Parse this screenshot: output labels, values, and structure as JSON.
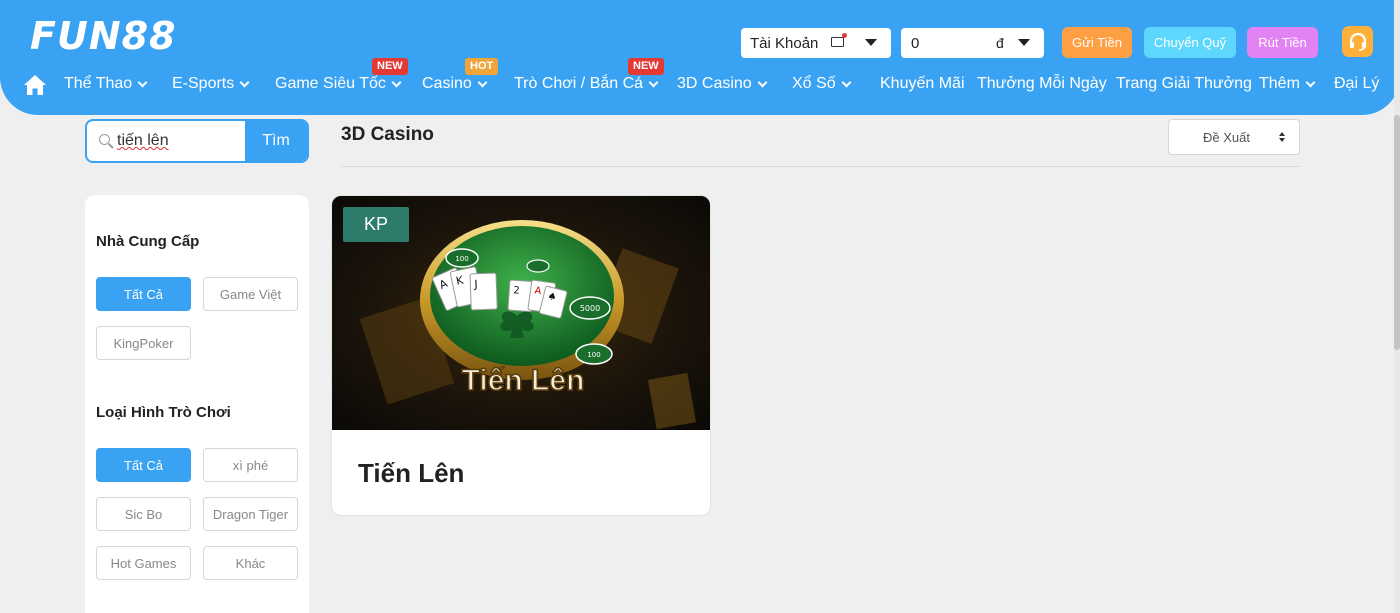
{
  "header": {
    "logo": "FUN88",
    "account_label": "Tài Khoản",
    "balance_value": "0",
    "currency_symbol": "đ",
    "deposit_label": "Gửi Tiền",
    "transfer_label": "Chuyển Quỹ",
    "withdraw_label": "Rút Tiền",
    "colors": {
      "header_bg": "#3aa2f3",
      "deposit": "#ff9f43",
      "transfer": "#5ed7ff",
      "withdraw": "#e382f5",
      "support": "#ffb03a"
    }
  },
  "nav": {
    "home_icon": "home-icon",
    "items": [
      {
        "label": "Thể Thao",
        "dropdown": true
      },
      {
        "label": "E-Sports",
        "dropdown": true
      },
      {
        "label": "Game Siêu Tốc",
        "dropdown": true,
        "badge": "NEW"
      },
      {
        "label": "Casino",
        "dropdown": true,
        "badge": "HOT"
      },
      {
        "label": "Trò Chơi / Bắn Cá",
        "dropdown": true,
        "badge": "NEW"
      },
      {
        "label": "3D Casino",
        "dropdown": true
      },
      {
        "label": "Xổ Số",
        "dropdown": true
      },
      {
        "label": "Khuyến Mãi",
        "dropdown": false
      },
      {
        "label": "Thưởng Mỗi Ngày",
        "dropdown": false
      },
      {
        "label": "Trang Giải Thưởng",
        "dropdown": false
      },
      {
        "label": "Thêm",
        "dropdown": true
      },
      {
        "label": "Đại Lý",
        "dropdown": false
      }
    ]
  },
  "search": {
    "value": "tiến lên",
    "button_label": "Tìm"
  },
  "sidebar": {
    "provider_title": "Nhà Cung Cấp",
    "providers": [
      {
        "label": "Tất Cả",
        "active": true
      },
      {
        "label": "Game Việt",
        "active": false
      },
      {
        "label": "KingPoker",
        "active": false
      }
    ],
    "gametype_title": "Loại Hình Trò Chơi",
    "gametypes": [
      {
        "label": "Tất Cả",
        "active": true
      },
      {
        "label": "xì phé",
        "active": false
      },
      {
        "label": "Sic Bo",
        "active": false
      },
      {
        "label": "Dragon Tiger",
        "active": false
      },
      {
        "label": "Hot Games",
        "active": false
      },
      {
        "label": "Khác",
        "active": false
      }
    ]
  },
  "main": {
    "title": "3D Casino",
    "sort_label": "Đề Xuất",
    "games": [
      {
        "provider_badge": "KP",
        "name": "Tiến Lên",
        "thumbnail_title": "Tiến Lên",
        "chips": [
          "100",
          "5000",
          "100"
        ]
      }
    ]
  }
}
